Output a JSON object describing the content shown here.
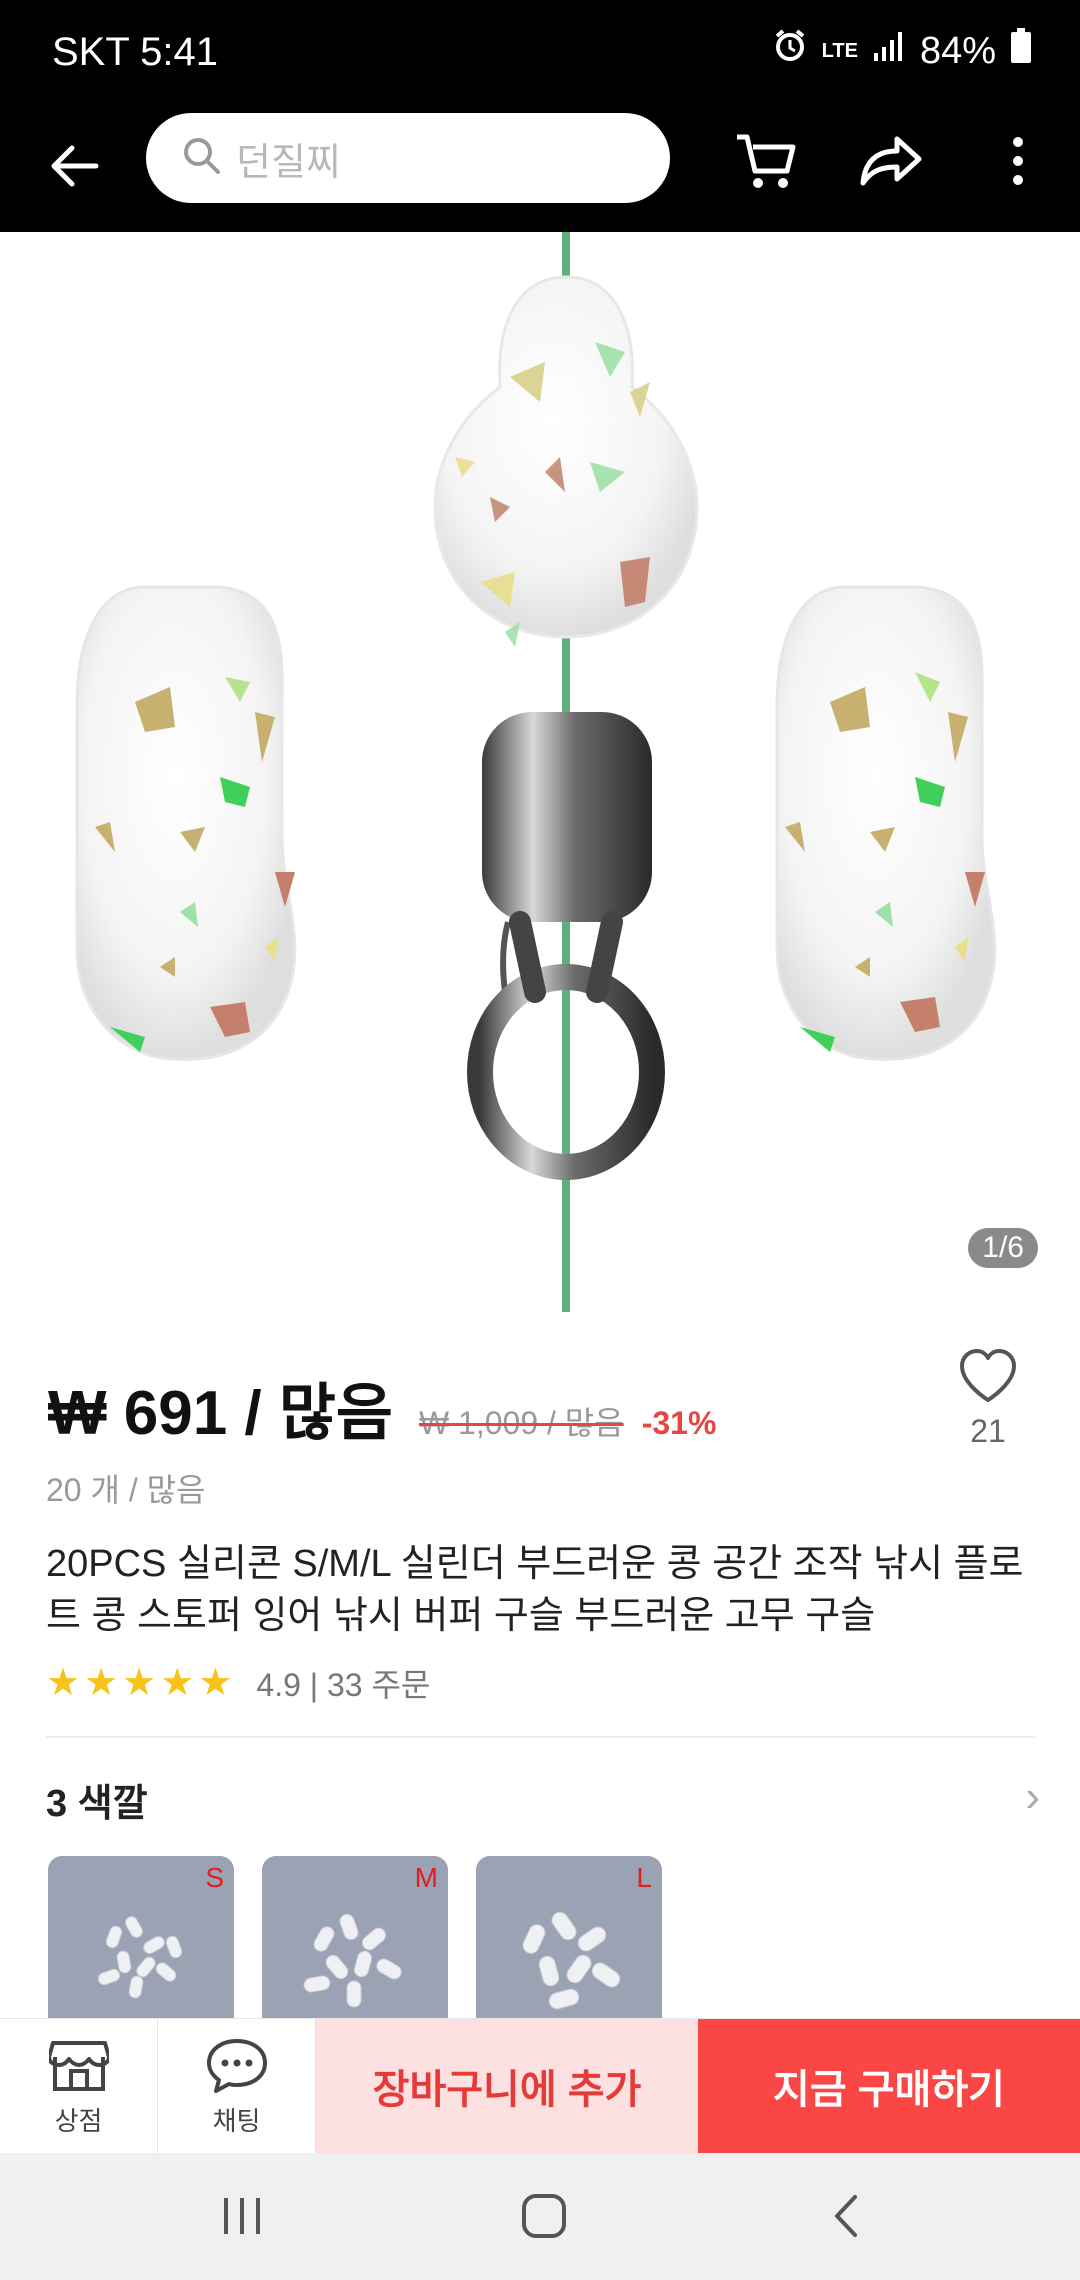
{
  "status_bar": {
    "carrier_time": "SKT 5:41",
    "network": "LTE",
    "battery": "84%"
  },
  "toolbar": {
    "search_placeholder": "던질찌",
    "icons": [
      "back-arrow-icon",
      "search-icon",
      "cart-icon",
      "share-icon",
      "more-icon"
    ]
  },
  "gallery": {
    "page_indicator": "1/6"
  },
  "product": {
    "price": "₩ 691 / 많음",
    "original_price": "₩ 1,009 / 많음",
    "discount": "-31%",
    "wishlist_count": "21",
    "unit": "20 개 / 많음",
    "title": "20PCS 실리콘 S/M/L 실린더 부드러운 콩 공간 조작 낚시 플로트 콩 스토퍼 잉어 낚시 버퍼 구슬 부드러운 고무 구슬",
    "rating": 4.9,
    "rating_text": "4.9 | 33 주문",
    "stars": 5
  },
  "variants": {
    "heading": "3 색깔",
    "options": [
      {
        "label": "S"
      },
      {
        "label": "M"
      },
      {
        "label": "L"
      }
    ]
  },
  "action_bar": {
    "store_label": "상점",
    "chat_label": "채팅",
    "add_to_cart": "장바구니에 추가",
    "buy_now": "지금 구매하기",
    "colors": {
      "add_bg": "#fde1e1",
      "add_text": "#e43a3a",
      "buy_bg": "#fb4646"
    }
  }
}
